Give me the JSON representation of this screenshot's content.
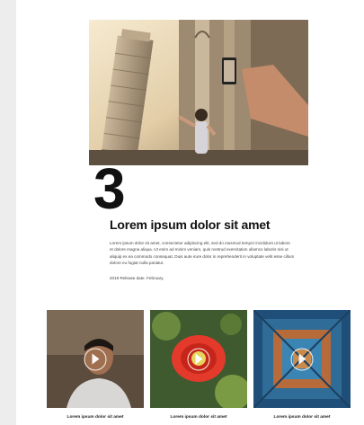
{
  "feature": {
    "number": "3",
    "headline": "Lorem ipsum dolor sit amet",
    "body": "Lorem ipsum dolor sit amet, consectetur adipiscing elit, sed do eiusmod tempor incididunt ut labore et dolore magna aliqua. Ut enim ad minim veniam, quis nostrud exercitation ullamco laboris nisi ut aliquip ex ea commodo consequat. Duis aute irure dolor in reprehenderit in voluptate velit esse cillum dolore eu fugiat nulla pariatur.",
    "release": "2019 Release date. February."
  },
  "thumbnails": [
    {
      "caption": "Lorem ipsum dolor sit amet",
      "icon": "play-icon"
    },
    {
      "caption": "Lorem ipsum dolor sit amet",
      "icon": "play-icon"
    },
    {
      "caption": "Lorem ipsum dolor sit amet",
      "icon": "play-icon"
    }
  ]
}
